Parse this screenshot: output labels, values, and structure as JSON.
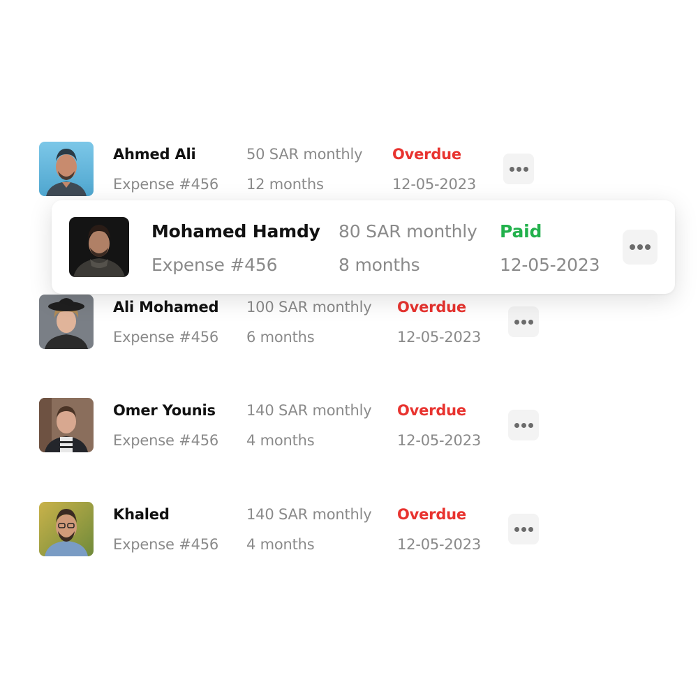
{
  "colors": {
    "overdue": "#e8332f",
    "paid": "#22b14c",
    "name": "#111111",
    "secondary": "#8a8a8a",
    "more_button_bg": "#f3f3f3"
  },
  "rows": [
    {
      "name": "Ahmed Ali",
      "expense": "Expense #456",
      "amount": "50 SAR monthly",
      "duration": "12 months",
      "status": "Overdue",
      "date": "12-05-2023",
      "avatar": "avatar-photo",
      "more_icon": "more-horizontal-icon"
    },
    {
      "name": "Mohamed Hamdy",
      "expense": "Expense #456",
      "amount": "80 SAR monthly",
      "duration": "8 months",
      "status": "Paid",
      "date": "12-05-2023",
      "avatar": "avatar-photo",
      "more_icon": "more-horizontal-icon",
      "highlighted": true
    },
    {
      "name": "Ali Mohamed",
      "expense": "Expense #456",
      "amount": "100 SAR monthly",
      "duration": "6 months",
      "status": "Overdue",
      "date": "12-05-2023",
      "avatar": "avatar-photo",
      "more_icon": "more-horizontal-icon"
    },
    {
      "name": "Omer Younis",
      "expense": "Expense #456",
      "amount": "140 SAR monthly",
      "duration": "4 months",
      "status": "Overdue",
      "date": "12-05-2023",
      "avatar": "avatar-photo",
      "more_icon": "more-horizontal-icon"
    },
    {
      "name": "Khaled",
      "expense": "Expense #456",
      "amount": "140 SAR monthly",
      "duration": "4 months",
      "status": "Overdue",
      "date": "12-05-2023",
      "avatar": "avatar-photo",
      "more_icon": "more-horizontal-icon"
    }
  ]
}
